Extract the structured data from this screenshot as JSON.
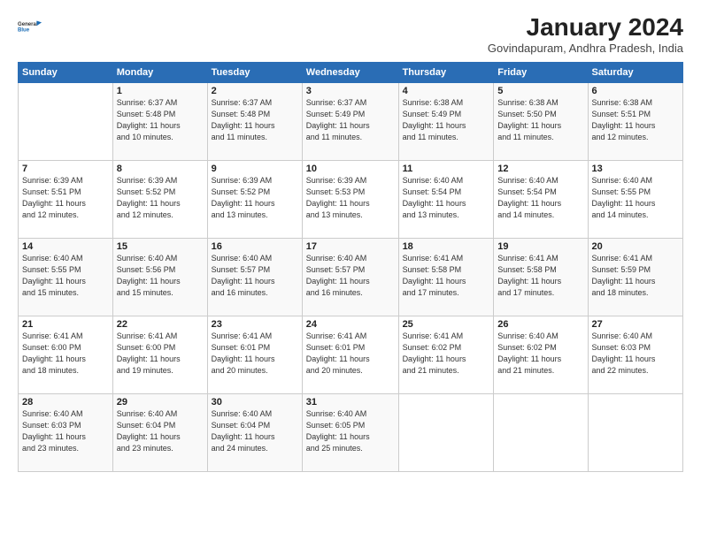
{
  "logo": {
    "line1": "General",
    "line2": "Blue"
  },
  "title": "January 2024",
  "location": "Govindapuram, Andhra Pradesh, India",
  "days_of_week": [
    "Sunday",
    "Monday",
    "Tuesday",
    "Wednesday",
    "Thursday",
    "Friday",
    "Saturday"
  ],
  "weeks": [
    [
      {
        "day": "",
        "info": ""
      },
      {
        "day": "1",
        "info": "Sunrise: 6:37 AM\nSunset: 5:48 PM\nDaylight: 11 hours\nand 10 minutes."
      },
      {
        "day": "2",
        "info": "Sunrise: 6:37 AM\nSunset: 5:48 PM\nDaylight: 11 hours\nand 11 minutes."
      },
      {
        "day": "3",
        "info": "Sunrise: 6:37 AM\nSunset: 5:49 PM\nDaylight: 11 hours\nand 11 minutes."
      },
      {
        "day": "4",
        "info": "Sunrise: 6:38 AM\nSunset: 5:49 PM\nDaylight: 11 hours\nand 11 minutes."
      },
      {
        "day": "5",
        "info": "Sunrise: 6:38 AM\nSunset: 5:50 PM\nDaylight: 11 hours\nand 11 minutes."
      },
      {
        "day": "6",
        "info": "Sunrise: 6:38 AM\nSunset: 5:51 PM\nDaylight: 11 hours\nand 12 minutes."
      }
    ],
    [
      {
        "day": "7",
        "info": "Sunrise: 6:39 AM\nSunset: 5:51 PM\nDaylight: 11 hours\nand 12 minutes."
      },
      {
        "day": "8",
        "info": "Sunrise: 6:39 AM\nSunset: 5:52 PM\nDaylight: 11 hours\nand 12 minutes."
      },
      {
        "day": "9",
        "info": "Sunrise: 6:39 AM\nSunset: 5:52 PM\nDaylight: 11 hours\nand 13 minutes."
      },
      {
        "day": "10",
        "info": "Sunrise: 6:39 AM\nSunset: 5:53 PM\nDaylight: 11 hours\nand 13 minutes."
      },
      {
        "day": "11",
        "info": "Sunrise: 6:40 AM\nSunset: 5:54 PM\nDaylight: 11 hours\nand 13 minutes."
      },
      {
        "day": "12",
        "info": "Sunrise: 6:40 AM\nSunset: 5:54 PM\nDaylight: 11 hours\nand 14 minutes."
      },
      {
        "day": "13",
        "info": "Sunrise: 6:40 AM\nSunset: 5:55 PM\nDaylight: 11 hours\nand 14 minutes."
      }
    ],
    [
      {
        "day": "14",
        "info": "Sunrise: 6:40 AM\nSunset: 5:55 PM\nDaylight: 11 hours\nand 15 minutes."
      },
      {
        "day": "15",
        "info": "Sunrise: 6:40 AM\nSunset: 5:56 PM\nDaylight: 11 hours\nand 15 minutes."
      },
      {
        "day": "16",
        "info": "Sunrise: 6:40 AM\nSunset: 5:57 PM\nDaylight: 11 hours\nand 16 minutes."
      },
      {
        "day": "17",
        "info": "Sunrise: 6:40 AM\nSunset: 5:57 PM\nDaylight: 11 hours\nand 16 minutes."
      },
      {
        "day": "18",
        "info": "Sunrise: 6:41 AM\nSunset: 5:58 PM\nDaylight: 11 hours\nand 17 minutes."
      },
      {
        "day": "19",
        "info": "Sunrise: 6:41 AM\nSunset: 5:58 PM\nDaylight: 11 hours\nand 17 minutes."
      },
      {
        "day": "20",
        "info": "Sunrise: 6:41 AM\nSunset: 5:59 PM\nDaylight: 11 hours\nand 18 minutes."
      }
    ],
    [
      {
        "day": "21",
        "info": "Sunrise: 6:41 AM\nSunset: 6:00 PM\nDaylight: 11 hours\nand 18 minutes."
      },
      {
        "day": "22",
        "info": "Sunrise: 6:41 AM\nSunset: 6:00 PM\nDaylight: 11 hours\nand 19 minutes."
      },
      {
        "day": "23",
        "info": "Sunrise: 6:41 AM\nSunset: 6:01 PM\nDaylight: 11 hours\nand 20 minutes."
      },
      {
        "day": "24",
        "info": "Sunrise: 6:41 AM\nSunset: 6:01 PM\nDaylight: 11 hours\nand 20 minutes."
      },
      {
        "day": "25",
        "info": "Sunrise: 6:41 AM\nSunset: 6:02 PM\nDaylight: 11 hours\nand 21 minutes."
      },
      {
        "day": "26",
        "info": "Sunrise: 6:40 AM\nSunset: 6:02 PM\nDaylight: 11 hours\nand 21 minutes."
      },
      {
        "day": "27",
        "info": "Sunrise: 6:40 AM\nSunset: 6:03 PM\nDaylight: 11 hours\nand 22 minutes."
      }
    ],
    [
      {
        "day": "28",
        "info": "Sunrise: 6:40 AM\nSunset: 6:03 PM\nDaylight: 11 hours\nand 23 minutes."
      },
      {
        "day": "29",
        "info": "Sunrise: 6:40 AM\nSunset: 6:04 PM\nDaylight: 11 hours\nand 23 minutes."
      },
      {
        "day": "30",
        "info": "Sunrise: 6:40 AM\nSunset: 6:04 PM\nDaylight: 11 hours\nand 24 minutes."
      },
      {
        "day": "31",
        "info": "Sunrise: 6:40 AM\nSunset: 6:05 PM\nDaylight: 11 hours\nand 25 minutes."
      },
      {
        "day": "",
        "info": ""
      },
      {
        "day": "",
        "info": ""
      },
      {
        "day": "",
        "info": ""
      }
    ]
  ]
}
